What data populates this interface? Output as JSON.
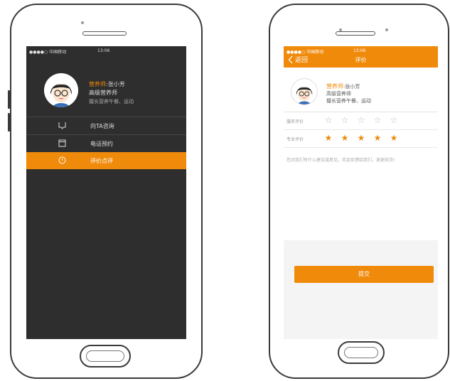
{
  "left_screen": {
    "status": {
      "carrier": "●●●●○ 中国移动",
      "time": "13:06"
    },
    "profile": {
      "role": "营养师",
      "name": ":张小芳",
      "title": "高级营养师",
      "specialty": "擅长营养午餐、运动"
    },
    "menu": [
      {
        "label": "向TA咨询",
        "icon": "chat-icon",
        "active": false
      },
      {
        "label": "电话预约",
        "icon": "calendar-icon",
        "active": false
      },
      {
        "label": "评价点评",
        "icon": "rating-icon",
        "active": true
      }
    ]
  },
  "right_screen": {
    "status": {
      "carrier": "●●●●○ 中国移动",
      "time": "13:06"
    },
    "nav": {
      "back_label": "返回",
      "title": "评价"
    },
    "profile": {
      "role": "营养师",
      "name": ":张小芳",
      "title": "高级营养师",
      "specialty": "擅长营养午餐、运动"
    },
    "ratings": [
      {
        "label": "服务评价",
        "stars": 0
      },
      {
        "label": "专业评价",
        "stars": 5
      }
    ],
    "comment_placeholder": "您对我们有什么建议或意见，欢迎反馈给我们，谢谢支持!",
    "submit_label": "提交"
  },
  "colors": {
    "accent": "#f08a0b",
    "dark_bg": "#2e2e2e"
  }
}
